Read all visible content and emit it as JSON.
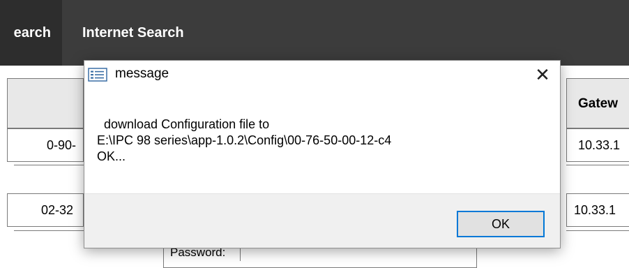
{
  "nav": {
    "tabs": [
      {
        "label": "earch"
      },
      {
        "label": "Internet Search"
      }
    ]
  },
  "table": {
    "header_gateway": "Gatew",
    "rows": [
      {
        "mac_partial": "0-90-",
        "gateway_partial": "10.33.1"
      },
      {
        "mac_partial": "02-32",
        "gateway_partial": "10.33.1"
      }
    ],
    "password_label": "Password:"
  },
  "dialog": {
    "title": "message",
    "close_glyph": "✕",
    "message_lines": [
      "download Configuration file to",
      "E:\\IPC 98 series\\app-1.0.2\\Config\\00-76-50-00-12-c4",
      "OK..."
    ],
    "ok_label": "OK",
    "accent_color": "#0078d7"
  }
}
